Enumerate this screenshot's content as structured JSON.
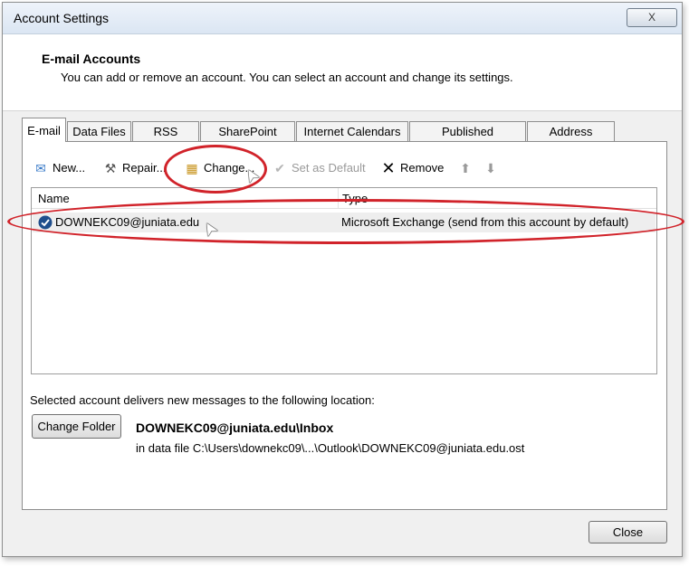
{
  "window": {
    "title": "Account Settings",
    "close_glyph": "X"
  },
  "header": {
    "title": "E-mail Accounts",
    "description": "You can add or remove an account. You can select an account and change its settings."
  },
  "tabs": [
    {
      "label": "E-mail",
      "active": true
    },
    {
      "label": "Data Files"
    },
    {
      "label": "RSS Feeds"
    },
    {
      "label": "SharePoint Lists"
    },
    {
      "label": "Internet Calendars"
    },
    {
      "label": "Published Calendars"
    },
    {
      "label": "Address Books"
    }
  ],
  "toolbar": {
    "new": "New...",
    "repair": "Repair...",
    "change": "Change...",
    "set_default": "Set as Default",
    "remove": "Remove"
  },
  "list": {
    "col_name": "Name",
    "col_type": "Type",
    "rows": [
      {
        "name": "DOWNEKC09@juniata.edu",
        "type": "Microsoft Exchange (send from this account by default)"
      }
    ]
  },
  "delivery": {
    "text": "Selected account delivers new messages to the following location:",
    "change_folder": "Change Folder",
    "location": "DOWNEKC09@juniata.edu\\Inbox",
    "data_file": "in data file C:\\Users\\downekc09\\...\\Outlook\\DOWNEKC09@juniata.edu.ost"
  },
  "footer": {
    "close": "Close"
  },
  "colors": {
    "annotation": "#d1232a",
    "selected_row": "#eeeeee"
  }
}
